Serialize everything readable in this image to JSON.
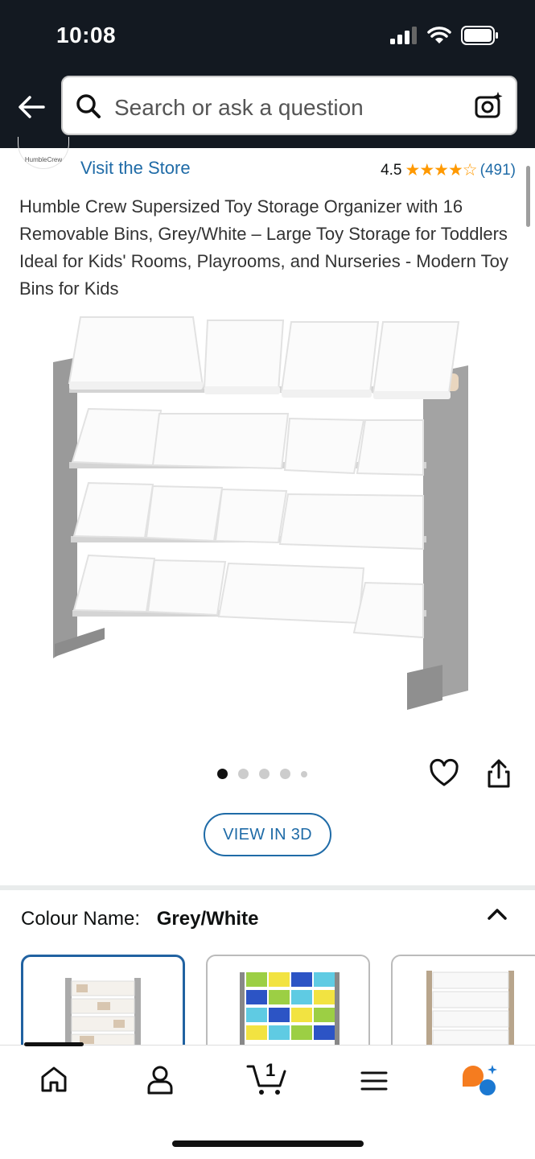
{
  "status": {
    "time": "10:08"
  },
  "search": {
    "placeholder": "Search or ask a question"
  },
  "brand": {
    "logo_text": "HumbleCrew",
    "visit_store": "Visit the Store"
  },
  "rating": {
    "value": "4.5",
    "stars": "★★★★☆",
    "count": "(491)"
  },
  "product": {
    "title": "Humble Crew Supersized Toy Storage Organizer with 16 Removable Bins, Grey/White – Large Toy Storage for Toddlers Ideal for Kids' Rooms, Playrooms, and Nurseries - Modern Toy Bins for Kids"
  },
  "gallery": {
    "image_count": 5,
    "active_index": 0
  },
  "view3d": {
    "label": "VIEW IN 3D"
  },
  "colour": {
    "label": "Colour Name:",
    "value": "Grey/White"
  },
  "swatches": [
    {
      "name": "Grey/White",
      "selected": true
    },
    {
      "name": "Multicolor",
      "selected": false
    },
    {
      "name": "Natural/White",
      "selected": false
    }
  ],
  "nav": {
    "cart_count": "1",
    "items": [
      "home-icon",
      "account-icon",
      "cart-icon",
      "menu-icon",
      "rufus-icon"
    ]
  },
  "colors": {
    "header_bg": "#131921",
    "link": "#1f6ba7",
    "star": "#ff9900",
    "selected_border": "#2162a1"
  }
}
